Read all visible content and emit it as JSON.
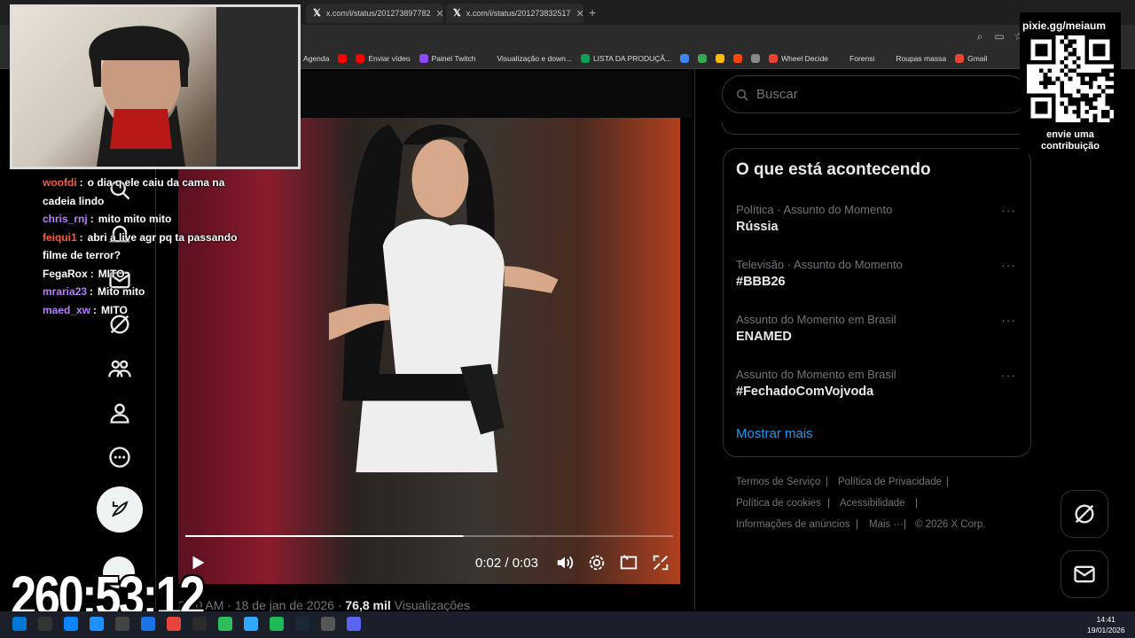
{
  "browser": {
    "tabs": [
      {
        "title": "x.com/i/status/201273897782"
      },
      {
        "title": "x.com/i/status/201273832517"
      }
    ],
    "new_tab": "+",
    "bookmarks": [
      {
        "label": "Agenda",
        "color": "#d93025"
      },
      {
        "label": "",
        "color": "#ff0000"
      },
      {
        "label": "Enviar vídeo",
        "color": "#ff0000"
      },
      {
        "label": "Painel Twitch",
        "color": "#9146ff"
      },
      {
        "label": "Visualização e down...",
        "color": "#2b2b2b"
      },
      {
        "label": "LISTA DA PRODUÇÃ...",
        "color": "#0f9d58"
      },
      {
        "label": "",
        "color": "#4285f4"
      },
      {
        "label": "",
        "color": "#34a853"
      },
      {
        "label": "",
        "color": "#fbbc05"
      },
      {
        "label": "",
        "color": "#ff4500"
      },
      {
        "label": "",
        "color": "#888888"
      },
      {
        "label": "Wheel Decide",
        "color": "#ea4335"
      },
      {
        "label": "Forensi",
        "color": "#2b2b2b"
      },
      {
        "label": "Roupas massa",
        "color": "#2b2b2b"
      },
      {
        "label": "Gmail",
        "color": "#ea4335"
      }
    ]
  },
  "video": {
    "current_time": "0:02",
    "separator": "/",
    "duration": "0:03",
    "progress": 0.57
  },
  "post_meta": {
    "time": "2:10 AM",
    "date": "18 de jan de 2026",
    "views_count": "76,8 mil",
    "views_label": "Visualizações"
  },
  "sidebar": {
    "search_placeholder": "Buscar",
    "trends_title": "O que está acontecendo",
    "trends": [
      {
        "meta": "Política · Assunto do Momento",
        "name": "Rússia"
      },
      {
        "meta": "Televisão · Assunto do Momento",
        "name": "#BBB26"
      },
      {
        "meta": "Assunto do Momento em Brasil",
        "name": "ENAMED"
      },
      {
        "meta": "Assunto do Momento em Brasil",
        "name": "#FechadoComVojvoda"
      }
    ],
    "more_glyph": "···",
    "show_more": "Mostrar mais",
    "footer": {
      "terms": "Termos de Serviço",
      "privacy": "Política de Privacidade",
      "cookies": "Política de cookies",
      "accessibility": "Acessibilidade",
      "ads": "Informações de anúncios",
      "more": "Mais ···",
      "copyright": "© 2026 X Corp.",
      "sep": "|"
    }
  },
  "stream": {
    "qr_title": "pixie.gg/meiaum",
    "qr_caption": "envie uma contribuição",
    "timer": "260:53:12",
    "chat": [
      {
        "user": "woofdi",
        "color": "#ff5a3c",
        "text": "o dia q ele caiu da cama na cadeia lindo"
      },
      {
        "user": "chris_rnj",
        "color": "#b77dff",
        "text": "mito mito mito"
      },
      {
        "user": "feiqui1",
        "color": "#ff5a3c",
        "text": "abri a live agr pq ta passando filme de terror?"
      },
      {
        "user": "FegaRox",
        "color": "#ffffff",
        "text": "MITO"
      },
      {
        "user": "mraria23",
        "color": "#b77dff",
        "text": "Mito mito"
      },
      {
        "user": "maed_xw",
        "color": "#b77dff",
        "text": "MITO"
      }
    ],
    "chat_sep": ":"
  },
  "taskbar": {
    "time": "14:41",
    "date": "19/01/2026"
  }
}
